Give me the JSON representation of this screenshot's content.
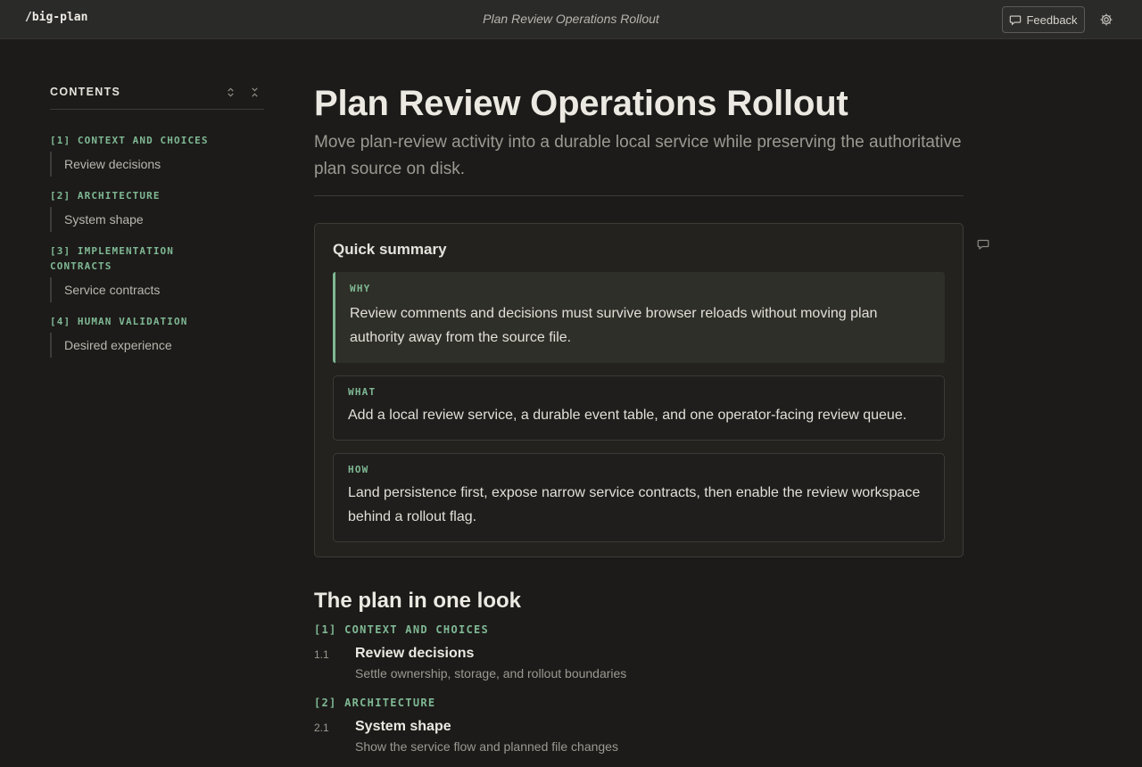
{
  "app": {
    "brand": "/big-plan",
    "window_title": "Plan Review Operations Rollout",
    "feedback_label": "Feedback"
  },
  "sidebar": {
    "title": "CONTENTS",
    "sections": [
      {
        "label": "[1] CONTEXT AND CHOICES",
        "item": "Review decisions"
      },
      {
        "label": "[2] ARCHITECTURE",
        "item": "System shape"
      },
      {
        "label": "[3] IMPLEMENTATION CONTRACTS",
        "item": "Service contracts"
      },
      {
        "label": "[4] HUMAN VALIDATION",
        "item": "Desired experience"
      }
    ]
  },
  "main": {
    "title": "Plan Review Operations Rollout",
    "subtitle": "Move plan-review activity into a durable local service while preserving the authoritative plan source on disk.",
    "summary": {
      "title": "Quick summary",
      "why": {
        "label": "WHY",
        "text": "Review comments and decisions must survive browser reloads without moving plan authority away from the source file."
      },
      "what": {
        "label": "WHAT",
        "text": "Add a local review service, a durable event table, and one operator-facing review queue."
      },
      "how": {
        "label": "HOW",
        "text": "Land persistence first, expose narrow service contracts, then enable the review workspace behind a rollout flag."
      }
    },
    "plan": {
      "heading": "The plan in one look",
      "sections": [
        {
          "label": "[1] CONTEXT AND CHOICES",
          "num": "1.1",
          "title": "Review decisions",
          "desc": "Settle ownership, storage, and rollout boundaries"
        },
        {
          "label": "[2] ARCHITECTURE",
          "num": "2.1",
          "title": "System shape",
          "desc": "Show the service flow and planned file changes"
        }
      ]
    }
  },
  "colors": {
    "accent": "#7fb894",
    "background": "#1c1b19",
    "topbar": "#2a2a29"
  }
}
